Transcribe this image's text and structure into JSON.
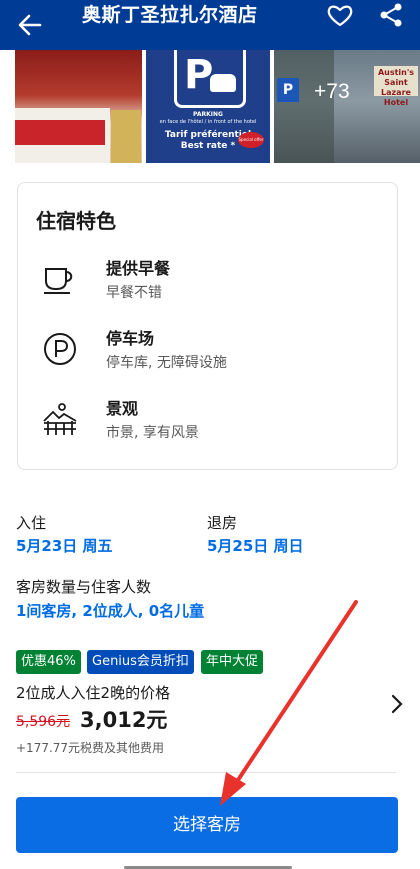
{
  "header": {
    "title": "奥斯丁圣拉扎尔酒店",
    "icons": {
      "back": "back-arrow-icon",
      "favorite": "heart-icon",
      "share": "share-icon"
    }
  },
  "photos": {
    "parking_sign": {
      "letter": "P",
      "line1": "PARKING",
      "line2": "en face de l'hôtel / in front of the hotel",
      "line3": "Tarif préférentiel",
      "line4": "Best rate *",
      "ribbon": "Special offer"
    },
    "hotel_sign": "Austin's Saint Lazare Hotel",
    "street_sign_letter": "P",
    "more_count": "+73"
  },
  "features": {
    "heading": "住宿特色",
    "items": [
      {
        "icon": "coffee-cup-icon",
        "name": "提供早餐",
        "desc": "早餐不错"
      },
      {
        "icon": "parking-icon",
        "name": "停车场",
        "desc": "停车库, 无障碍设施"
      },
      {
        "icon": "landscape-view-icon",
        "name": "景观",
        "desc": "市景, 享有风景"
      }
    ]
  },
  "booking": {
    "checkin_label": "入住",
    "checkin_value": "5月23日 周五",
    "checkout_label": "退房",
    "checkout_value": "5月25日 周日",
    "rooms_label": "客房数量与住客人数",
    "rooms_value": "1间客房, 2位成人, 0名儿童"
  },
  "badges": [
    "优惠46%",
    "Genius会员折扣",
    "年中大促"
  ],
  "price": {
    "label": "2位成人入住2晚的价格",
    "original": "5,596元",
    "current": "3,012元",
    "tax_note": "+177.77元税费及其他费用"
  },
  "cta": {
    "label": "选择客房"
  },
  "colors": {
    "header_bg": "#003b95",
    "link_blue": "#006ce4",
    "button_blue": "#0a6de4",
    "badge_green": "#008234",
    "badge_blue": "#004cb8",
    "strike_red": "#d4111e",
    "annotation_arrow": "#e8322b"
  }
}
